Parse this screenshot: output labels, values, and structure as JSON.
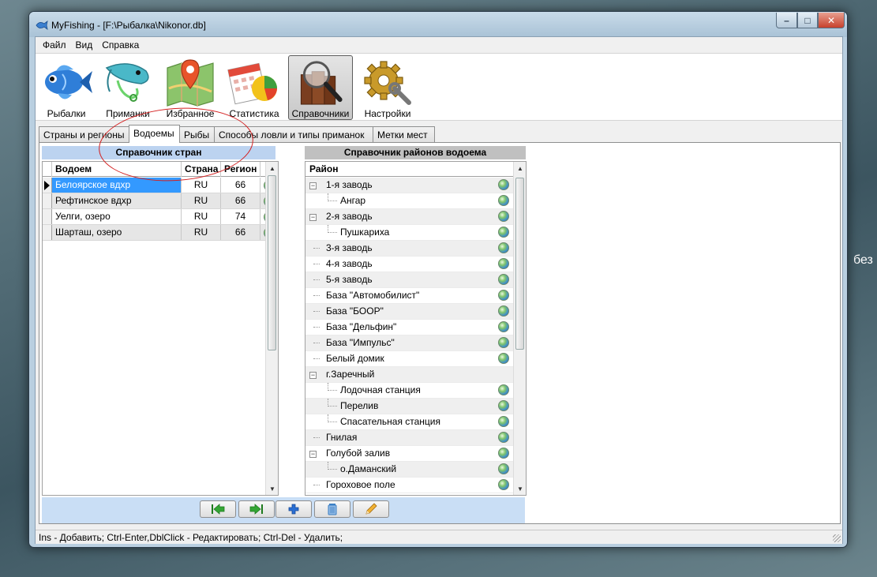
{
  "desktop": {
    "text": "без"
  },
  "window": {
    "title": "MyFishing - [F:\\Рыбалка\\Nikonor.db]",
    "caption": {
      "min": "–",
      "max": "□",
      "close": "✕"
    }
  },
  "menu": [
    "Файл",
    "Вид",
    "Справка"
  ],
  "toolbar": [
    {
      "label": "Рыбалки",
      "icon": "fish-icon"
    },
    {
      "label": "Приманки",
      "icon": "shrimp-lure-icon"
    },
    {
      "label": "Избранное",
      "icon": "map-pin-icon"
    },
    {
      "label": "Статистика",
      "icon": "chart-calendar-icon"
    },
    {
      "label": "Справочники",
      "icon": "books-magnifier-icon",
      "active": true
    },
    {
      "label": "Настройки",
      "icon": "gears-icon"
    }
  ],
  "tabs": [
    {
      "label": "Страны и регионы"
    },
    {
      "label": "Водоемы",
      "active": true
    },
    {
      "label": "Рыбы"
    },
    {
      "label": "Способы ловли и типы приманок"
    },
    {
      "label": "Метки мест"
    }
  ],
  "left_panel": {
    "title": "Справочник стран",
    "columns": {
      "name": "Водоем",
      "country": "Страна",
      "region": "Регион"
    },
    "rows": [
      {
        "name": "Белоярское вдхр",
        "country": "RU",
        "region": "66",
        "selected": true
      },
      {
        "name": "Рефтинское вдхр",
        "country": "RU",
        "region": "66"
      },
      {
        "name": "Уелги, озеро",
        "country": "RU",
        "region": "74"
      },
      {
        "name": "Шарташ, озеро",
        "country": "RU",
        "region": "66"
      }
    ]
  },
  "bottom_buttons": [
    {
      "name": "first-record-button",
      "icon": "arrow-left-icon",
      "color": "#2e9b2e"
    },
    {
      "name": "last-record-button",
      "icon": "arrow-right-icon",
      "color": "#2e9b2e"
    },
    {
      "name": "add-button",
      "icon": "plus-icon",
      "color": "#2a6fd4"
    },
    {
      "name": "delete-button",
      "icon": "trash-icon",
      "color": "#3b7fc4"
    },
    {
      "name": "edit-button",
      "icon": "pencil-icon",
      "color": "#e8a020"
    }
  ],
  "right_panel": {
    "title": "Справочник районов водоема",
    "column": "Район",
    "items": [
      {
        "label": "1-я заводь",
        "level": 0,
        "expander": "−",
        "globe": true
      },
      {
        "label": "Ангар",
        "level": 1,
        "globe": true
      },
      {
        "label": "2-я заводь",
        "level": 0,
        "expander": "−",
        "globe": true
      },
      {
        "label": "Пушкариха",
        "level": 1,
        "globe": true
      },
      {
        "label": "3-я заводь",
        "level": 0,
        "globe": true
      },
      {
        "label": "4-я заводь",
        "level": 0,
        "globe": true
      },
      {
        "label": "5-я заводь",
        "level": 0,
        "globe": true
      },
      {
        "label": "База \"Автомобилист\"",
        "level": 0,
        "globe": true
      },
      {
        "label": "База \"БООР\"",
        "level": 0,
        "globe": true
      },
      {
        "label": "База \"Дельфин\"",
        "level": 0,
        "globe": true
      },
      {
        "label": "База \"Импульс\"",
        "level": 0,
        "globe": true
      },
      {
        "label": "Белый домик",
        "level": 0,
        "globe": true
      },
      {
        "label": "г.Заречный",
        "level": 0,
        "expander": "−",
        "globe": false
      },
      {
        "label": "Лодочная станция",
        "level": 1,
        "globe": true
      },
      {
        "label": "Перелив",
        "level": 1,
        "globe": true
      },
      {
        "label": "Спасательная станция",
        "level": 1,
        "globe": true
      },
      {
        "label": "Гнилая",
        "level": 0,
        "globe": true
      },
      {
        "label": "Голубой залив",
        "level": 0,
        "expander": "−",
        "globe": true
      },
      {
        "label": "о.Даманский",
        "level": 1,
        "globe": true
      },
      {
        "label": "Гороховое поле",
        "level": 0,
        "globe": true
      }
    ]
  },
  "status": "Ins - Добавить; Ctrl-Enter,DblClick - Редактировать; Ctrl-Del - Удалить;"
}
